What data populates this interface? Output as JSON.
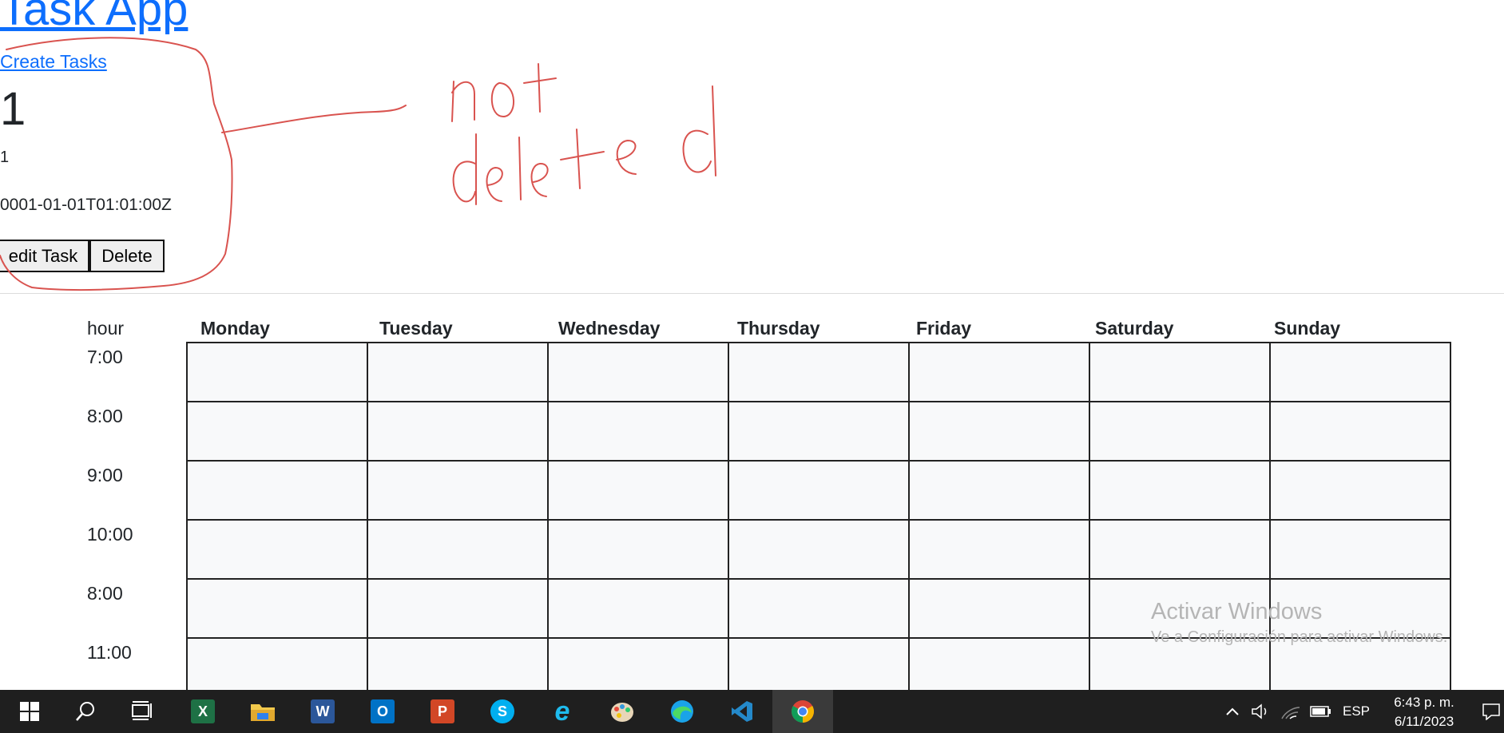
{
  "app": {
    "title": "Task App",
    "create_link": "Create Tasks"
  },
  "task": {
    "title": "1",
    "description": "1",
    "date": "0001-01-01T01:01:00Z",
    "edit_label": "edit Task",
    "delete_label": "Delete"
  },
  "annotation": {
    "text": "not deleted",
    "color": "#d9534f"
  },
  "schedule": {
    "hour_header": "hour",
    "days": [
      "Monday",
      "Tuesday",
      "Wednesday",
      "Thursday",
      "Friday",
      "Saturday",
      "Sunday"
    ],
    "hours": [
      "7:00",
      "8:00",
      "9:00",
      "10:00",
      "8:00",
      "11:00"
    ]
  },
  "watermark": {
    "title": "Activar Windows",
    "subtitle": "Ve a Configuración para activar Windows."
  },
  "taskbar": {
    "apps": [
      "start-icon",
      "search-icon",
      "task-view-icon",
      "excel-icon",
      "file-explorer-icon",
      "word-icon",
      "outlook-icon",
      "powerpoint-icon",
      "skype-icon",
      "internet-explorer-icon",
      "paint-icon",
      "edge-icon",
      "vscode-icon",
      "chrome-icon"
    ],
    "language": "ESP",
    "time": "6:43 p. m.",
    "date": "6/11/2023"
  },
  "colors": {
    "link": "#0d6efd",
    "cell_bg": "#f8f9fa",
    "taskbar_bg": "#1f1f1f"
  }
}
